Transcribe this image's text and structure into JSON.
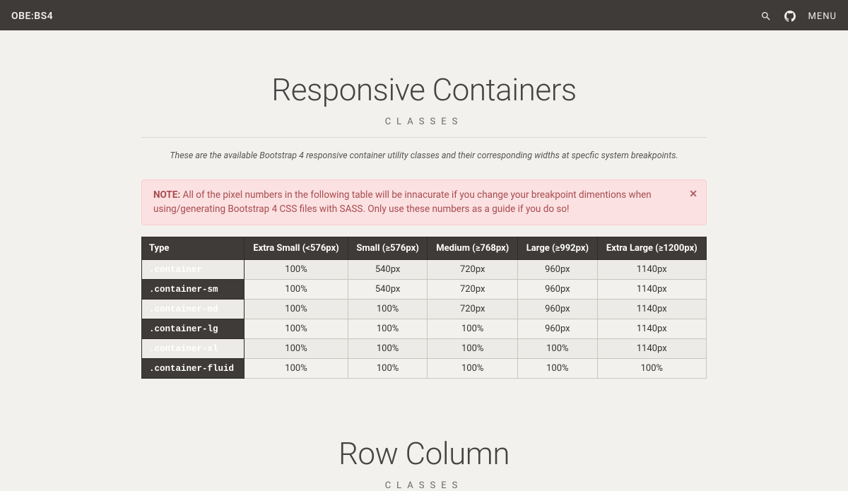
{
  "nav": {
    "brand": "OBE:BS4",
    "menu": "MENU"
  },
  "section1": {
    "title": "Responsive Containers",
    "sub": "CLASSES",
    "lead": "These are the available Bootstrap 4 responsive container utility classes and their corresponding widths at specfic system breakpoints.",
    "alert_note": "NOTE:",
    "alert_body": " All of the pixel numbers in the following table will be innacurate if you change your breakpoint dimentions when using/generating Bootstrap 4 CSS files with SASS. Only use these numbers as a guide if you do so!",
    "table": {
      "headers": [
        "Type",
        "Extra Small (<576px)",
        "Small (≥576px)",
        "Medium (≥768px)",
        "Large (≥992px)",
        "Extra Large (≥1200px)"
      ],
      "rows": [
        [
          ".container",
          "100%",
          "540px",
          "720px",
          "960px",
          "1140px"
        ],
        [
          ".container-sm",
          "100%",
          "540px",
          "720px",
          "960px",
          "1140px"
        ],
        [
          ".container-md",
          "100%",
          "100%",
          "720px",
          "960px",
          "1140px"
        ],
        [
          ".container-lg",
          "100%",
          "100%",
          "100%",
          "960px",
          "1140px"
        ],
        [
          ".container-xl",
          "100%",
          "100%",
          "100%",
          "100%",
          "1140px"
        ],
        [
          ".container-fluid",
          "100%",
          "100%",
          "100%",
          "100%",
          "100%"
        ]
      ]
    }
  },
  "section2": {
    "title": "Row Column",
    "sub": "CLASSES"
  }
}
